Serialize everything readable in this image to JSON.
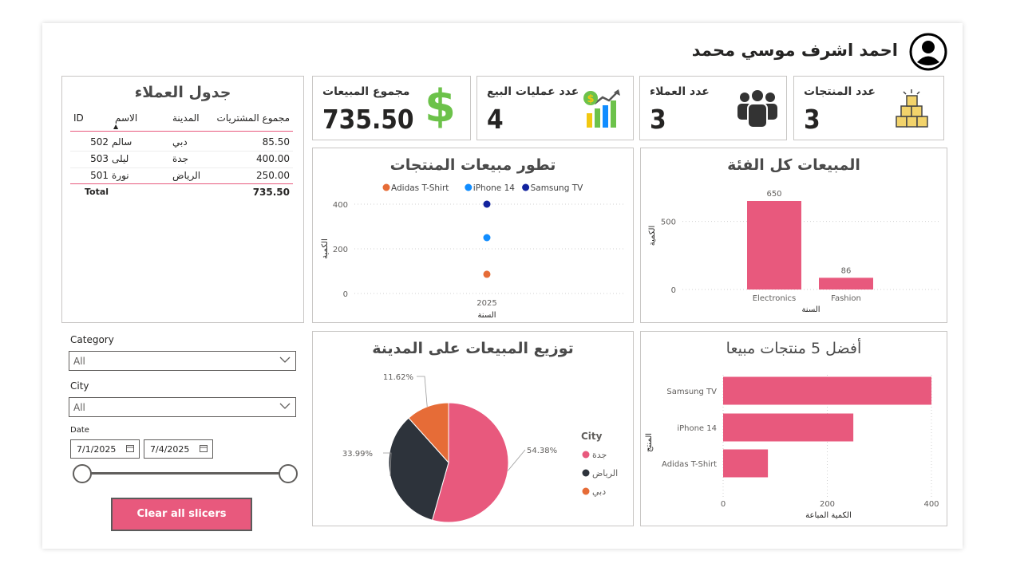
{
  "header": {
    "user_name": "احمد اشرف موسي محمد"
  },
  "kpis": {
    "total_sales": {
      "label": "مجموع المبيعات",
      "value": "735.50"
    },
    "sales_count": {
      "label": "عدد عمليات البيع",
      "value": "4"
    },
    "customers_count": {
      "label": "عدد العملاء",
      "value": "3"
    },
    "products_count": {
      "label": "عدد المنتجات",
      "value": "3"
    }
  },
  "customers_table": {
    "title": "جدول العملاء",
    "columns": {
      "id": "ID",
      "name": "الاسم",
      "city": "المدينة",
      "total": "مجموع المشتريات"
    },
    "rows": [
      {
        "id": "502",
        "name": "سالم",
        "city": "دبي",
        "total": "85.50"
      },
      {
        "id": "503",
        "name": "ليلى",
        "city": "جدة",
        "total": "400.00"
      },
      {
        "id": "501",
        "name": "نورة",
        "city": "الرياض",
        "total": "250.00"
      }
    ],
    "total_label": "Total",
    "total_value": "735.50"
  },
  "filters": {
    "category": {
      "label": "Category",
      "value": "All"
    },
    "city": {
      "label": "City",
      "value": "All"
    },
    "date": {
      "label": "Date",
      "start": "7/1/2025",
      "end": "7/4/2025",
      "range_start": 0,
      "range_end": 1
    },
    "clear_button": "Clear all slicers"
  },
  "colors": {
    "accent": "#e8597d",
    "kpi_green": "#6cc24a",
    "line1": "#e66c37",
    "line2": "#118dff",
    "line3": "#12239e",
    "pie_dark": "#2d333b"
  },
  "chart_data": [
    {
      "type": "scatter",
      "title": "تطور مبيعات المنتجات",
      "xlabel": "السنة",
      "ylabel": "الكمية",
      "x": [
        "2025"
      ],
      "yticks": [
        "0",
        "200",
        "400"
      ],
      "ylim": [
        0,
        400
      ],
      "series": [
        {
          "name": "Adidas T-Shirt",
          "color": "#e66c37",
          "values": [
            86
          ]
        },
        {
          "name": "iPhone 14",
          "color": "#118dff",
          "values": [
            250
          ]
        },
        {
          "name": "Samsung TV",
          "color": "#12239e",
          "values": [
            400
          ]
        }
      ]
    },
    {
      "type": "bar",
      "title": "المبيعات كل الفئة",
      "xlabel": "السنة",
      "ylabel": "الكمية",
      "categories": [
        "Electronics",
        "Fashion"
      ],
      "values": [
        650,
        86
      ],
      "data_labels": [
        "650",
        "86"
      ],
      "yticks": [
        "0",
        "500"
      ],
      "ylim": [
        0,
        650
      ]
    },
    {
      "type": "pie",
      "title": "توزيع المبيعات على المدينة",
      "legend_title": "City",
      "slices": [
        {
          "name": "جدة",
          "value": 54.38,
          "label": "54.38%",
          "color": "#e8597d"
        },
        {
          "name": "الرياض",
          "value": 33.99,
          "label": "33.99%",
          "color": "#2d333b"
        },
        {
          "name": "دبي",
          "value": 11.62,
          "label": "11.62%",
          "color": "#e66c37"
        }
      ]
    },
    {
      "type": "bar",
      "orientation": "horizontal",
      "title": "أفضل 5 منتجات مبيعا",
      "xlabel": "الكمية المباعة",
      "ylabel": "المنتج",
      "categories": [
        "Samsung TV",
        "iPhone 14",
        "Adidas T-Shirt"
      ],
      "values": [
        400,
        250,
        86
      ],
      "xticks": [
        "0",
        "200",
        "400"
      ],
      "xlim": [
        0,
        400
      ]
    }
  ]
}
